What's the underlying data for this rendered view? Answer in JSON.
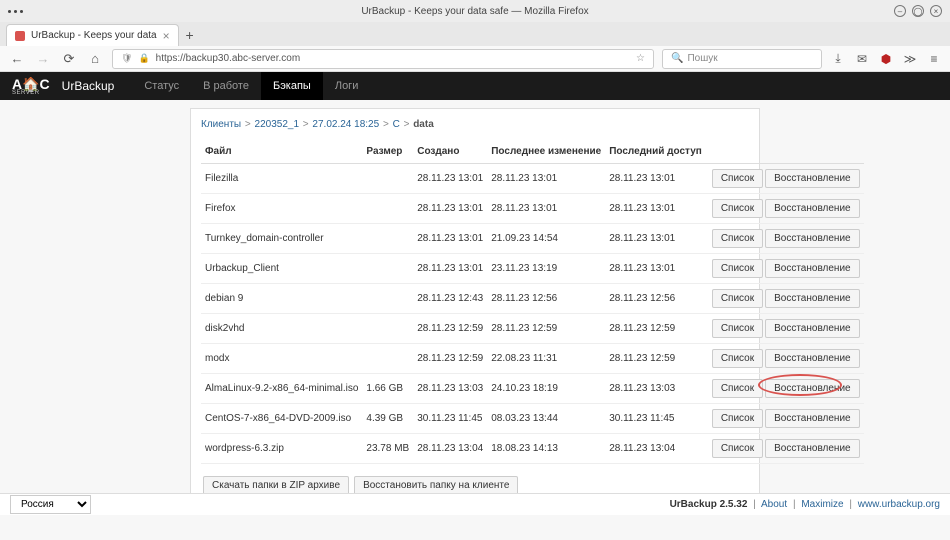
{
  "window": {
    "title": "UrBackup - Keeps your data safe — Mozilla Firefox",
    "tab_title": "UrBackup - Keeps your data",
    "url": "https://backup30.abc-server.com",
    "search_placeholder": "Пошук"
  },
  "app": {
    "name": "UrBackup",
    "nav": {
      "status": "Статус",
      "inprogress": "В работе",
      "backups": "Бэкапы",
      "logs": "Логи"
    }
  },
  "breadcrumb": {
    "clients": "Клиенты",
    "client_id": "220352_1",
    "backup_time": "27.02.24 18:25",
    "drive": "C",
    "folder": "data"
  },
  "table": {
    "headers": {
      "file": "Файл",
      "size": "Размер",
      "created": "Создано",
      "modified": "Последнее изменение",
      "accessed": "Последний доступ"
    },
    "rows": [
      {
        "name": "Filezilla",
        "size": "",
        "created": "28.11.23 13:01",
        "modified": "28.11.23 13:01",
        "accessed": "28.11.23 13:01"
      },
      {
        "name": "Firefox",
        "size": "",
        "created": "28.11.23 13:01",
        "modified": "28.11.23 13:01",
        "accessed": "28.11.23 13:01"
      },
      {
        "name": "Turnkey_domain-controller",
        "size": "",
        "created": "28.11.23 13:01",
        "modified": "21.09.23 14:54",
        "accessed": "28.11.23 13:01"
      },
      {
        "name": "Urbackup_Client",
        "size": "",
        "created": "28.11.23 13:01",
        "modified": "23.11.23 13:19",
        "accessed": "28.11.23 13:01"
      },
      {
        "name": "debian 9",
        "size": "",
        "created": "28.11.23 12:43",
        "modified": "28.11.23 12:56",
        "accessed": "28.11.23 12:56"
      },
      {
        "name": "disk2vhd",
        "size": "",
        "created": "28.11.23 12:59",
        "modified": "28.11.23 12:59",
        "accessed": "28.11.23 12:59"
      },
      {
        "name": "modx",
        "size": "",
        "created": "28.11.23 12:59",
        "modified": "22.08.23 11:31",
        "accessed": "28.11.23 12:59"
      },
      {
        "name": "AlmaLinux-9.2-x86_64-minimal.iso",
        "size": "1.66 GB",
        "created": "28.11.23 13:03",
        "modified": "24.10.23 18:19",
        "accessed": "28.11.23 13:03",
        "highlight": true
      },
      {
        "name": "CentOS-7-x86_64-DVD-2009.iso",
        "size": "4.39 GB",
        "created": "30.11.23 11:45",
        "modified": "08.03.23 13:44",
        "accessed": "30.11.23 11:45"
      },
      {
        "name": "wordpress-6.3.zip",
        "size": "23.78 MB",
        "created": "28.11.23 13:04",
        "modified": "18.08.23 14:13",
        "accessed": "28.11.23 13:04"
      }
    ],
    "btn_list": "Список",
    "btn_restore": "Восстановление"
  },
  "actions": {
    "download_zip": "Скачать папки в ZIP архиве",
    "restore_on_client": "Восстановить папку на клиенте"
  },
  "footer": {
    "lang": "Россия",
    "version": "UrBackup 2.5.32",
    "about": "About",
    "maximize": "Maximize",
    "site": "www.urbackup.org"
  }
}
